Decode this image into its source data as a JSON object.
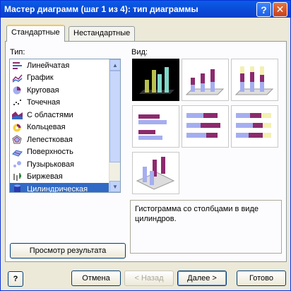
{
  "window": {
    "title": "Мастер диаграмм (шаг 1 из 4): тип диаграммы",
    "help_glyph": "?",
    "close_glyph": "✕"
  },
  "tabs": [
    {
      "label": "Стандартные",
      "active": true
    },
    {
      "label": "Нестандартные",
      "active": false
    }
  ],
  "type_label": "Тип:",
  "view_label": "Вид:",
  "chart_types": [
    {
      "label": "Линейчатая",
      "icon": "bar-chart-icon"
    },
    {
      "label": "График",
      "icon": "line-chart-icon"
    },
    {
      "label": "Круговая",
      "icon": "pie-chart-icon"
    },
    {
      "label": "Точечная",
      "icon": "scatter-chart-icon"
    },
    {
      "label": "С областями",
      "icon": "area-chart-icon"
    },
    {
      "label": "Кольцевая",
      "icon": "doughnut-chart-icon"
    },
    {
      "label": "Лепестковая",
      "icon": "radar-chart-icon"
    },
    {
      "label": "Поверхность",
      "icon": "surface-chart-icon"
    },
    {
      "label": "Пузырьковая",
      "icon": "bubble-chart-icon"
    },
    {
      "label": "Биржевая",
      "icon": "stock-chart-icon"
    },
    {
      "label": "Цилиндрическая",
      "icon": "cylinder-chart-icon",
      "selected": true
    }
  ],
  "description": "Гистограмма со столбцами в виде цилиндров.",
  "preview_button": "Просмотр результата",
  "footer": {
    "help": "?",
    "cancel": "Отмена",
    "back": "< Назад",
    "next": "Далее >",
    "finish": "Готово"
  },
  "colors": {
    "selected_row": "#316ac5",
    "cylinder_purple": "#8c2a6e",
    "cylinder_blue": "#a4aef0",
    "cylinder_yellow": "#f4f0b0"
  }
}
